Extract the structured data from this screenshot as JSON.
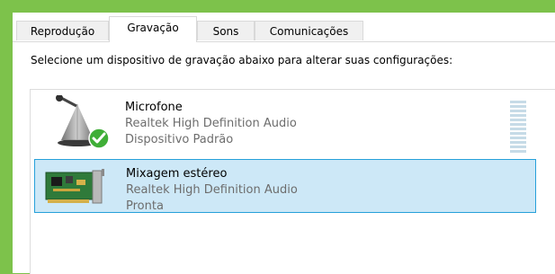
{
  "tabs": [
    {
      "label": "Reprodução",
      "active": false
    },
    {
      "label": "Gravação",
      "active": true
    },
    {
      "label": "Sons",
      "active": false
    },
    {
      "label": "Comunicações",
      "active": false
    }
  ],
  "instruction": "Selecione um dispositivo de gravação abaixo para alterar suas configurações:",
  "devices": [
    {
      "name": "Microfone",
      "driver": "Realtek High Definition Audio",
      "status": "Dispositivo Padrão",
      "icon": "microphone-icon",
      "default_badge": "check-icon",
      "selected": false
    },
    {
      "name": "Mixagem estéreo",
      "driver": "Realtek High Definition Audio",
      "status": "Pronta",
      "icon": "sound-card-icon",
      "selected": true
    }
  ],
  "level_meter": {
    "level": 0
  },
  "colors": {
    "background": "#7dc24b",
    "selection_fill": "#cde8f7",
    "selection_border": "#26a0da",
    "secondary_text": "#6d6d6d",
    "check_green": "#3fae37"
  }
}
